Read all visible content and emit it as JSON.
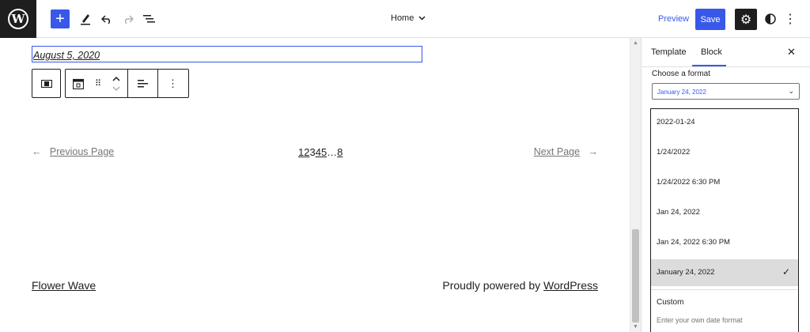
{
  "toolbar": {
    "doc_title": "Home",
    "preview_label": "Preview",
    "save_label": "Save"
  },
  "canvas": {
    "date_text": "August 5, 2020",
    "pagination": {
      "prev_arrow": "←",
      "prev_label": "Previous Page",
      "next_label": "Next Page",
      "next_arrow": "→",
      "pages": [
        "1",
        "2",
        "3",
        "4",
        "5"
      ],
      "ellipsis": "…",
      "last": "8"
    },
    "footer": {
      "site_name": "Flower Wave",
      "powered_text": "Proudly powered by ",
      "powered_link": "WordPress"
    }
  },
  "sidebar": {
    "tabs": [
      {
        "label": "Template"
      },
      {
        "label": "Block"
      }
    ],
    "format_label": "Choose a format",
    "format_value": "January 24, 2022",
    "options": [
      {
        "label": "2022-01-24",
        "selected": false
      },
      {
        "label": "1/24/2022",
        "selected": false
      },
      {
        "label": "1/24/2022 6:30 PM",
        "selected": false
      },
      {
        "label": "Jan 24, 2022",
        "selected": false
      },
      {
        "label": "Jan 24, 2022 6:30 PM",
        "selected": false
      },
      {
        "label": "January 24, 2022",
        "selected": true
      }
    ],
    "custom_label": "Custom",
    "custom_placeholder": "Enter your own date format"
  },
  "colors": {
    "accent": "#3858e9",
    "dark": "#1e1e1e",
    "muted": "#757575"
  }
}
